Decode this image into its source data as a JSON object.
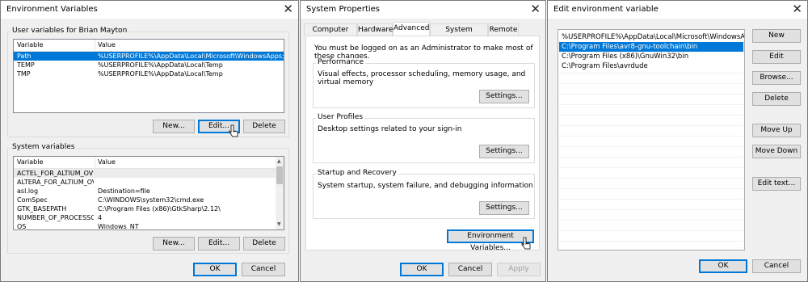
{
  "env_dialog": {
    "title": "Environment Variables",
    "user_group_label": "User variables for Brian Mayton",
    "columns": [
      "Variable",
      "Value"
    ],
    "user_vars": [
      {
        "name": "Path",
        "value": "%USERPROFILE%\\AppData\\Local\\Microsoft\\WindowsApps;C:\\Prog...",
        "selected": true
      },
      {
        "name": "TEMP",
        "value": "%USERPROFILE%\\AppData\\Local\\Temp"
      },
      {
        "name": "TMP",
        "value": "%USERPROFILE%\\AppData\\Local\\Temp"
      }
    ],
    "user_buttons": {
      "new": "New...",
      "edit": "Edit...",
      "delete": "Delete"
    },
    "system_group_label": "System variables",
    "system_vars": [
      {
        "name": "ACTEL_FOR_ALTIUM_OVERR...",
        "value": ""
      },
      {
        "name": "ALTERA_FOR_ALTIUM_OVER...",
        "value": ""
      },
      {
        "name": "asl.log",
        "value": "Destination=file"
      },
      {
        "name": "ComSpec",
        "value": "C:\\WINDOWS\\system32\\cmd.exe"
      },
      {
        "name": "GTK_BASEPATH",
        "value": "C:\\Program Files (x86)\\GtkSharp\\2.12\\"
      },
      {
        "name": "NUMBER_OF_PROCESSORS",
        "value": "4"
      },
      {
        "name": "OS",
        "value": "Windows_NT"
      }
    ],
    "system_buttons": {
      "new": "New...",
      "edit": "Edit...",
      "delete": "Delete"
    },
    "ok": "OK",
    "cancel": "Cancel"
  },
  "sys_props": {
    "title": "System Properties",
    "tabs": [
      "Computer Name",
      "Hardware",
      "Advanced",
      "System Protection",
      "Remote"
    ],
    "active_tab": "Advanced",
    "admin_note": "You must be logged on as an Administrator to make most of these changes.",
    "performance": {
      "label": "Performance",
      "desc": "Visual effects, processor scheduling, memory usage, and virtual memory",
      "button": "Settings..."
    },
    "user_profiles": {
      "label": "User Profiles",
      "desc": "Desktop settings related to your sign-in",
      "button": "Settings..."
    },
    "startup": {
      "label": "Startup and Recovery",
      "desc": "System startup, system failure, and debugging information",
      "button": "Settings..."
    },
    "env_button": "Environment Variables...",
    "ok": "OK",
    "cancel": "Cancel",
    "apply": "Apply"
  },
  "edit_env": {
    "title": "Edit environment variable",
    "items": [
      {
        "text": "%USERPROFILE%\\AppData\\Local\\Microsoft\\WindowsApps",
        "selected": false
      },
      {
        "text": "C:\\Program Files\\avr8-gnu-toolchain\\bin",
        "selected": true
      },
      {
        "text": "C:\\Program Files (x86)\\GnuWin32\\bin",
        "selected": false
      },
      {
        "text": "C:\\Program Files\\avrdude",
        "selected": false
      }
    ],
    "buttons": {
      "new": "New",
      "edit": "Edit",
      "browse": "Browse...",
      "delete": "Delete",
      "move_up": "Move Up",
      "move_down": "Move Down",
      "edit_text": "Edit text..."
    },
    "ok": "OK",
    "cancel": "Cancel"
  }
}
